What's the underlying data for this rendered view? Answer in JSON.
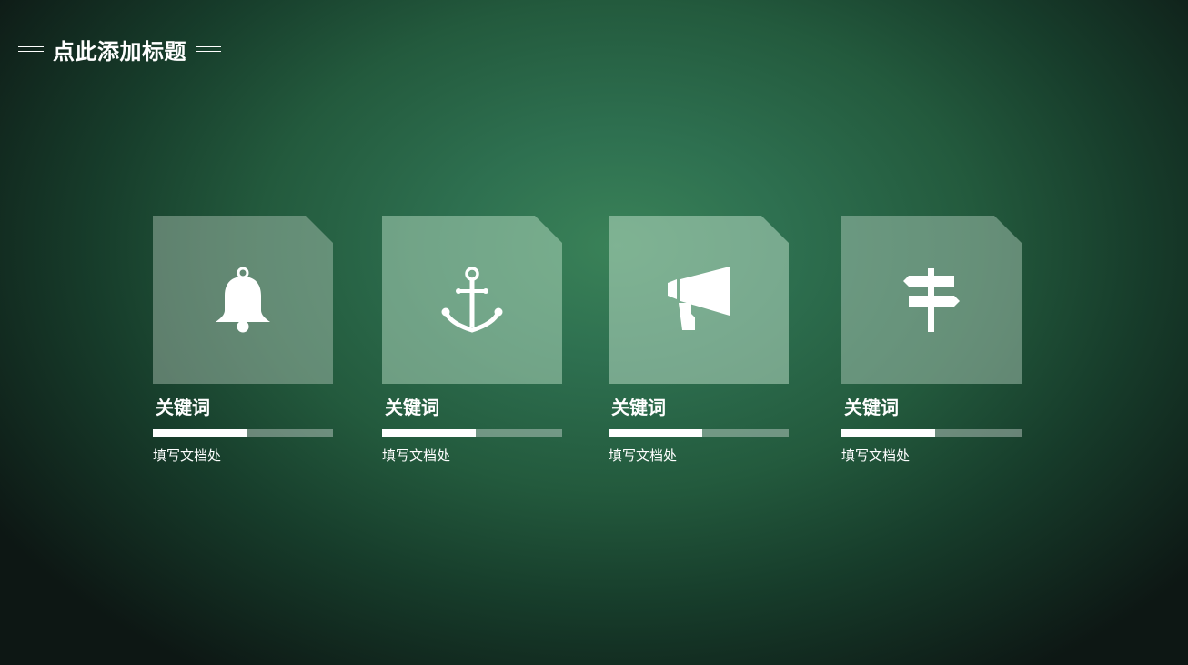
{
  "title": {
    "text": "点此添加标题"
  },
  "cards": [
    {
      "icon": "bell-icon",
      "keyword": "关键词",
      "progress": 0.52,
      "description": "填写文档处"
    },
    {
      "icon": "anchor-icon",
      "keyword": "关键词",
      "progress": 0.52,
      "description": "填写文档处"
    },
    {
      "icon": "megaphone-icon",
      "keyword": "关键词",
      "progress": 0.52,
      "description": "填写文档处"
    },
    {
      "icon": "signpost-icon",
      "keyword": "关键词",
      "progress": 0.52,
      "description": "填写文档处"
    }
  ],
  "colors": {
    "background_center": "#3a8258",
    "background_edge": "#0d1714",
    "text": "#ffffff"
  }
}
